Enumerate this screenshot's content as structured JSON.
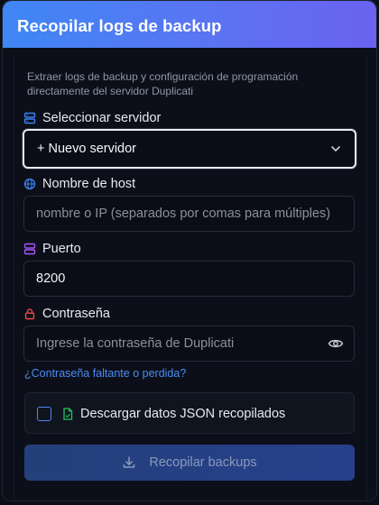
{
  "dialog": {
    "title": "Recopilar logs de backup",
    "description": "Extraer logs de backup y configuración de programación directamente del servidor Duplicati"
  },
  "server": {
    "label": "Seleccionar servidor",
    "selected": "+ Nuevo servidor"
  },
  "host": {
    "label": "Nombre de host",
    "placeholder": "nombre o IP (separados por comas para múltiples)"
  },
  "port": {
    "label": "Puerto",
    "value": "8200"
  },
  "password": {
    "label": "Contraseña",
    "placeholder": "Ingrese la contraseña de Duplicati",
    "forgot_link": "¿Contraseña faltante o perdida?"
  },
  "download_json": {
    "label": "Descargar datos JSON recopilados",
    "checked": false
  },
  "submit": {
    "label": "Recopilar backups"
  },
  "colors": {
    "accent": "#4a8cf6",
    "server_icon": "#3b82f6",
    "port_icon": "#a855f7",
    "password_icon": "#ef4444",
    "json_icon": "#22c55e"
  }
}
